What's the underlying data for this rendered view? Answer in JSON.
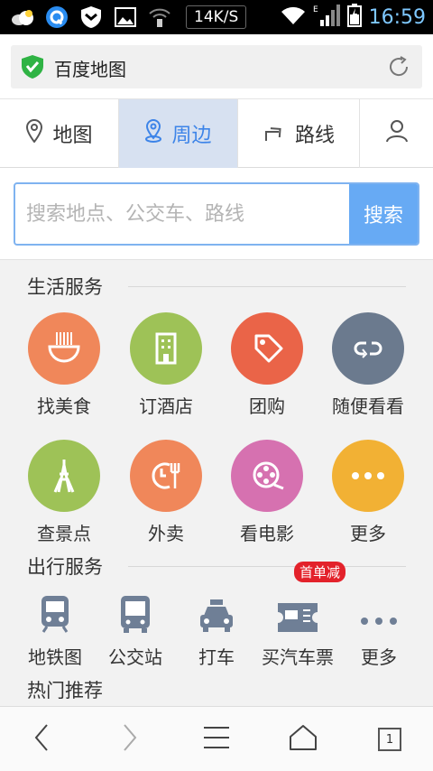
{
  "status_bar": {
    "net_speed": "14K/S",
    "time": "16:59"
  },
  "url_bar": {
    "title": "百度地图"
  },
  "tabs": [
    {
      "label": "地图"
    },
    {
      "label": "周边"
    },
    {
      "label": "路线"
    }
  ],
  "search": {
    "placeholder": "搜索地点、公交车、路线",
    "button": "搜索"
  },
  "life_services": {
    "title": "生活服务",
    "items": [
      {
        "label": "找美食",
        "color": "#f0875a"
      },
      {
        "label": "订酒店",
        "color": "#9ec257"
      },
      {
        "label": "团购",
        "color": "#ea6448"
      },
      {
        "label": "随便看看",
        "color": "#6b7a8e"
      },
      {
        "label": "查景点",
        "color": "#9ec257"
      },
      {
        "label": "外卖",
        "color": "#f0875a"
      },
      {
        "label": "看电影",
        "color": "#d671b0"
      },
      {
        "label": "更多",
        "color": "#f2b134"
      }
    ]
  },
  "travel_services": {
    "title": "出行服务",
    "items": [
      {
        "label": "地铁图"
      },
      {
        "label": "公交站"
      },
      {
        "label": "打车"
      },
      {
        "label": "买汽车票",
        "badge": "首单减"
      },
      {
        "label": "更多"
      }
    ]
  },
  "hot": {
    "title": "热门推荐"
  },
  "bottom_nav": {
    "tab_count": "1"
  }
}
